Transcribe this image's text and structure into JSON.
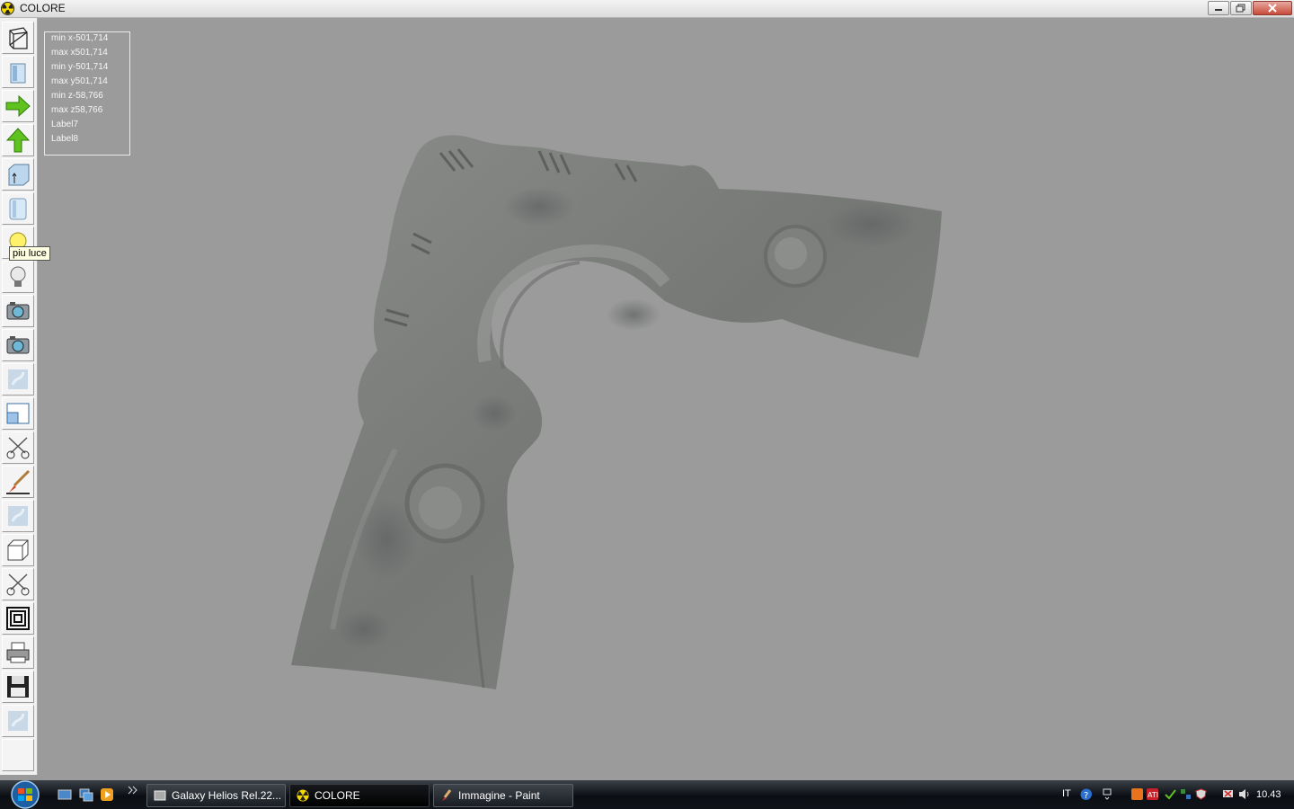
{
  "window": {
    "title": "COLORE"
  },
  "tooltip": {
    "text": "piu luce"
  },
  "info": {
    "lines": [
      "min x-501,714",
      "max x501,714",
      "min y-501,714",
      "max y501,714",
      "min z-58,766",
      "max z58,766",
      "Label7",
      "Label8"
    ]
  },
  "toolbar": {
    "items": [
      "wireframe-icon",
      "solid-view-icon",
      "arrow-right-icon",
      "arrow-up-icon",
      "cube-front-icon",
      "cylinder-icon",
      "light-bulb-yellow-icon",
      "light-bulb-icon",
      "camera-icon",
      "camera-icon",
      "texture-icon",
      "window-icon",
      "scissors-icon",
      "brush-icon",
      "texture-icon",
      "box-icon",
      "scissors-icon",
      "concentric-squares-icon",
      "printer-icon",
      "floppy-disk-icon",
      "texture-icon"
    ]
  },
  "taskbar": {
    "tasks": [
      {
        "label": "Galaxy Helios  Rel.22...",
        "icon": "galaxy-app-icon"
      },
      {
        "label": "COLORE",
        "icon": "radiation-icon",
        "active": true
      },
      {
        "label": "Immagine - Paint",
        "icon": "paint-icon"
      }
    ],
    "language": "IT",
    "clock": "10.43"
  },
  "colors": {
    "viewport": "#9b9b9b",
    "model": "#7d7f7d",
    "taskbar": "#15191e"
  }
}
